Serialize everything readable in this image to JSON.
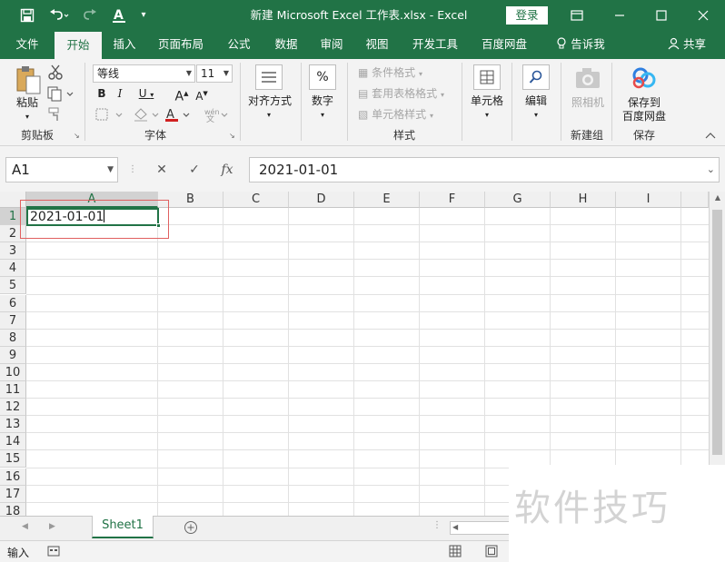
{
  "window": {
    "title": "新建 Microsoft Excel 工作表.xlsx  -  Excel",
    "login": "登录"
  },
  "quick_access": {
    "save_icon": "save-icon",
    "undo_icon": "undo-icon",
    "redo_icon": "redo-icon",
    "font_color_icon": "font-color-icon",
    "customize_icon": "customize-icon"
  },
  "window_controls": {
    "ribbon_display_icon": "ribbon-display-icon",
    "minimize_icon": "minimize-icon",
    "maximize_icon": "maximize-icon",
    "close_icon": "close-icon"
  },
  "tabs": [
    "文件",
    "开始",
    "插入",
    "页面布局",
    "公式",
    "数据",
    "审阅",
    "视图",
    "开发工具",
    "百度网盘"
  ],
  "active_tab": "开始",
  "tell_me": "告诉我",
  "share": "共享",
  "ribbon": {
    "clipboard": {
      "group": "剪贴板",
      "paste": "粘贴"
    },
    "font": {
      "group": "字体",
      "name": "等线",
      "size": "11"
    },
    "alignment": {
      "label": "对齐方式"
    },
    "number": {
      "label": "数字"
    },
    "styles": {
      "group": "样式",
      "conditional": "条件格式",
      "table": "套用表格格式",
      "cell": "单元格样式"
    },
    "cells": {
      "label": "单元格"
    },
    "editing": {
      "label": "编辑"
    },
    "camera": {
      "label": "照相机",
      "group": "新建组"
    },
    "baidu": {
      "label1": "保存到",
      "label2": "百度网盘",
      "group": "保存"
    }
  },
  "formula_bar": {
    "name_box": "A1",
    "cancel": "✕",
    "enter": "✓",
    "fx": "fx",
    "value": "2021-01-01"
  },
  "grid": {
    "columns": [
      "A",
      "B",
      "C",
      "D",
      "E",
      "F",
      "G",
      "H",
      "I"
    ],
    "rows": [
      "1",
      "2",
      "3",
      "4",
      "5",
      "6",
      "7",
      "8",
      "9",
      "10",
      "11",
      "12",
      "13",
      "14",
      "15",
      "16",
      "17",
      "18"
    ],
    "selected_cell": "A1",
    "cell_A1": "2021-01-01"
  },
  "sheet_tabs": {
    "active": "Sheet1"
  },
  "status": {
    "mode": "输入"
  },
  "watermark": "软件技巧",
  "colors": {
    "accent": "#217346",
    "highlight_box": "#e06060"
  }
}
